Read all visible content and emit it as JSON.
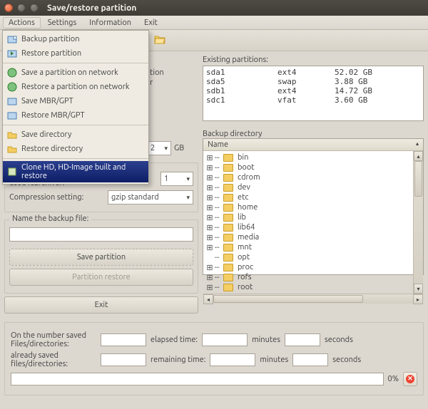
{
  "window": {
    "title": "Save/restore partition"
  },
  "menubar": [
    "Actions",
    "Settings",
    "Information",
    "Exit"
  ],
  "actions_menu": [
    "Backup partition",
    "Restore partition",
    "-",
    "Save a partition on network",
    "Restore a partition on network",
    "Save MBR/GPT",
    "Restore MBR/GPT",
    "-",
    "Save directory",
    "Restore directory",
    "-",
    "Clone HD, HD-Image built and restore"
  ],
  "left": {
    "hidden_suffix": "tion",
    "hidden_suffix2": "r",
    "size_suffix": "GB",
    "size_value": "2",
    "procs_label": "Number of processors cores for to be used fsarchiver:",
    "procs_value": "1",
    "comp_label": "Compression setting:",
    "comp_value": "gzip standard",
    "name_label": "Name the backup file:",
    "name_value": "",
    "btn_save": "Save partition",
    "btn_restore": "Partition restore",
    "btn_exit": "Exit"
  },
  "partitions": {
    "label": "Existing partitions:",
    "rows": [
      {
        "dev": "sda1",
        "fs": "ext4",
        "size": "52.02 GB"
      },
      {
        "dev": "sda5",
        "fs": "swap",
        "size": "3.88 GB"
      },
      {
        "dev": "sdb1",
        "fs": "ext4",
        "size": "14.72 GB"
      },
      {
        "dev": "sdc1",
        "fs": "vfat",
        "size": "3.60 GB"
      }
    ]
  },
  "backup_dir": {
    "label": "Backup directory",
    "header": "Name",
    "items": [
      "bin",
      "boot",
      "cdrom",
      "dev",
      "etc",
      "home",
      "lib",
      "lib64",
      "media",
      "mnt",
      "opt",
      "proc",
      "rofs",
      "root"
    ]
  },
  "stats": {
    "num_saved_label": "On the number saved Files/directories:",
    "elapsed_label": "elapsed time:",
    "minutes": "minutes",
    "seconds": "seconds",
    "already_label": "already saved files/directories:",
    "remaining_label": "remaining time:",
    "percent": "0%"
  }
}
